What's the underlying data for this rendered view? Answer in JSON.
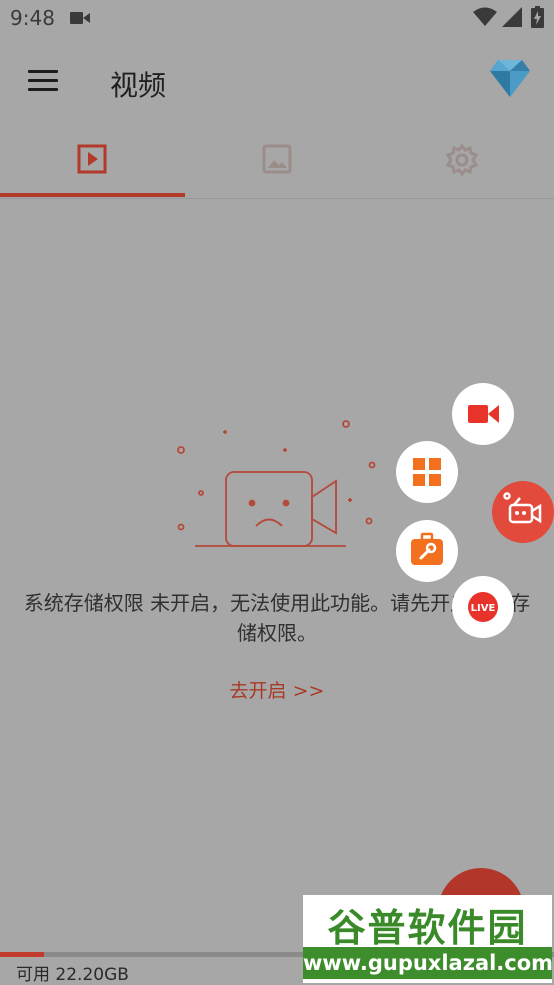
{
  "status_bar": {
    "time": "9:48"
  },
  "app_bar": {
    "title": "视频",
    "menu_icon": "hamburger-menu-icon",
    "premium_icon": "diamond-icon"
  },
  "tabs": [
    {
      "icon": "video-play-icon",
      "selected": true
    },
    {
      "icon": "image-icon",
      "selected": false
    },
    {
      "icon": "gear-icon",
      "selected": false
    }
  ],
  "empty_state": {
    "message": "系统存储权限 未开启，无法使用此功能。请先开启系统存储权限。",
    "link": "去开启 >>"
  },
  "fab_menu": [
    {
      "icon": "video-camera-icon",
      "color": "#e8332a"
    },
    {
      "icon": "grid-tools-icon",
      "color": "#f3701f"
    },
    {
      "icon": "toolbox-icon",
      "color": "#f3701f"
    },
    {
      "icon": "live-icon",
      "label": "LIVE",
      "color": "#e8332a"
    }
  ],
  "fab_main_icon": "camera-recorder-icon",
  "storage": {
    "label": "可用 22.20GB",
    "used_fraction": 0.08
  },
  "watermark": {
    "brand": "谷普软件园",
    "url": "www.gupuxlazal.com"
  },
  "colors": {
    "accent": "#b23a2b",
    "fab": "#e24a3b",
    "overlay_bg": "#a7a7a7"
  }
}
